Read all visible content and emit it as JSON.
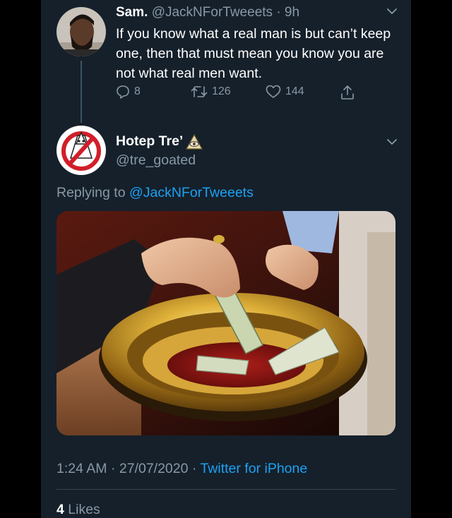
{
  "colors": {
    "background": "#15202b",
    "text_primary": "#ffffff",
    "text_secondary": "#8899a6",
    "link": "#1da1f2",
    "divider": "#38444d"
  },
  "parent_tweet": {
    "name": "Sam.",
    "handle": "@JackNForTweeets",
    "time": "· 9h",
    "text": "If you know what a real man is but can’t keep one, then that must mean you know you are not what real men want.",
    "actions": {
      "reply_icon": "comment-icon",
      "reply_count": "8",
      "retweet_icon": "retweet-icon",
      "retweet_count": "126",
      "like_icon": "heart-icon",
      "like_count": "144",
      "share_icon": "share-icon"
    }
  },
  "reply_tweet": {
    "name": "Hotep Tre’",
    "name_emoji_icon": "eye-pyramid-icon",
    "handle": "@tre_goated",
    "replying_prefix": "Replying to",
    "replying_to": "@JackNForTweeets",
    "media_icon": "offering-plate-photo",
    "time": "1:24 AM · 27/07/2020 ·",
    "app": "Twitter for iPhone",
    "likes_count": "4",
    "likes_label": "Likes"
  }
}
